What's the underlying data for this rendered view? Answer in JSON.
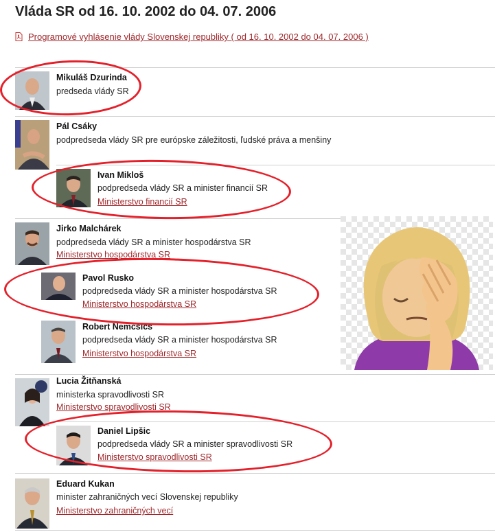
{
  "page_title": "Vláda SR od 16. 10. 2002 do 04. 07. 2006",
  "program_link": "Programové vyhlásenie vlády Slovenskej republiky ( od 16. 10. 2002 do 04. 07. 2006 )",
  "members": [
    {
      "name": "Mikuláš Dzurinda",
      "role": "predseda vlády SR",
      "link": ""
    },
    {
      "name": "Pál Csáky",
      "role": "podpredseda vlády SR pre európske záležitosti, ľudské práva a menšiny",
      "link": ""
    },
    {
      "name": "Ivan Mikloš",
      "role": "podpredseda vlády SR a minister financií SR",
      "link": "Ministerstvo financií SR"
    },
    {
      "name": "Jirko Malchárek",
      "role": "podpredseda vlády SR a minister hospodárstva SR",
      "link": "Ministerstvo hospodárstva SR"
    },
    {
      "name": "Pavol Rusko",
      "role": "podpredseda vlády SR a minister hospodárstva SR",
      "link": "Ministerstvo hospodárstva SR"
    },
    {
      "name": "Robert Nemcsics",
      "role": "podpredseda vlády SR a minister hospodárstva SR",
      "link": "Ministerstvo hospodárstva SR"
    },
    {
      "name": "Lucia Žitňanská",
      "role": "ministerka spravodlivosti SR",
      "link": "Ministerstvo spravodlivosti SR"
    },
    {
      "name": "Daniel Lipšic",
      "role": "podpredseda vlády SR a minister spravodlivosti SR",
      "link": "Ministerstvo spravodlivosti SR"
    },
    {
      "name": "Eduard Kukan",
      "role": "minister zahraničných vecí Slovenskej republiky",
      "link": "Ministerstvo zahraničných vecí"
    }
  ],
  "colors": {
    "accent": "#a0282c",
    "circle": "#e4202a"
  },
  "icons": {
    "pdf": "pdf-icon",
    "overlay": "facepalm-emoji"
  }
}
